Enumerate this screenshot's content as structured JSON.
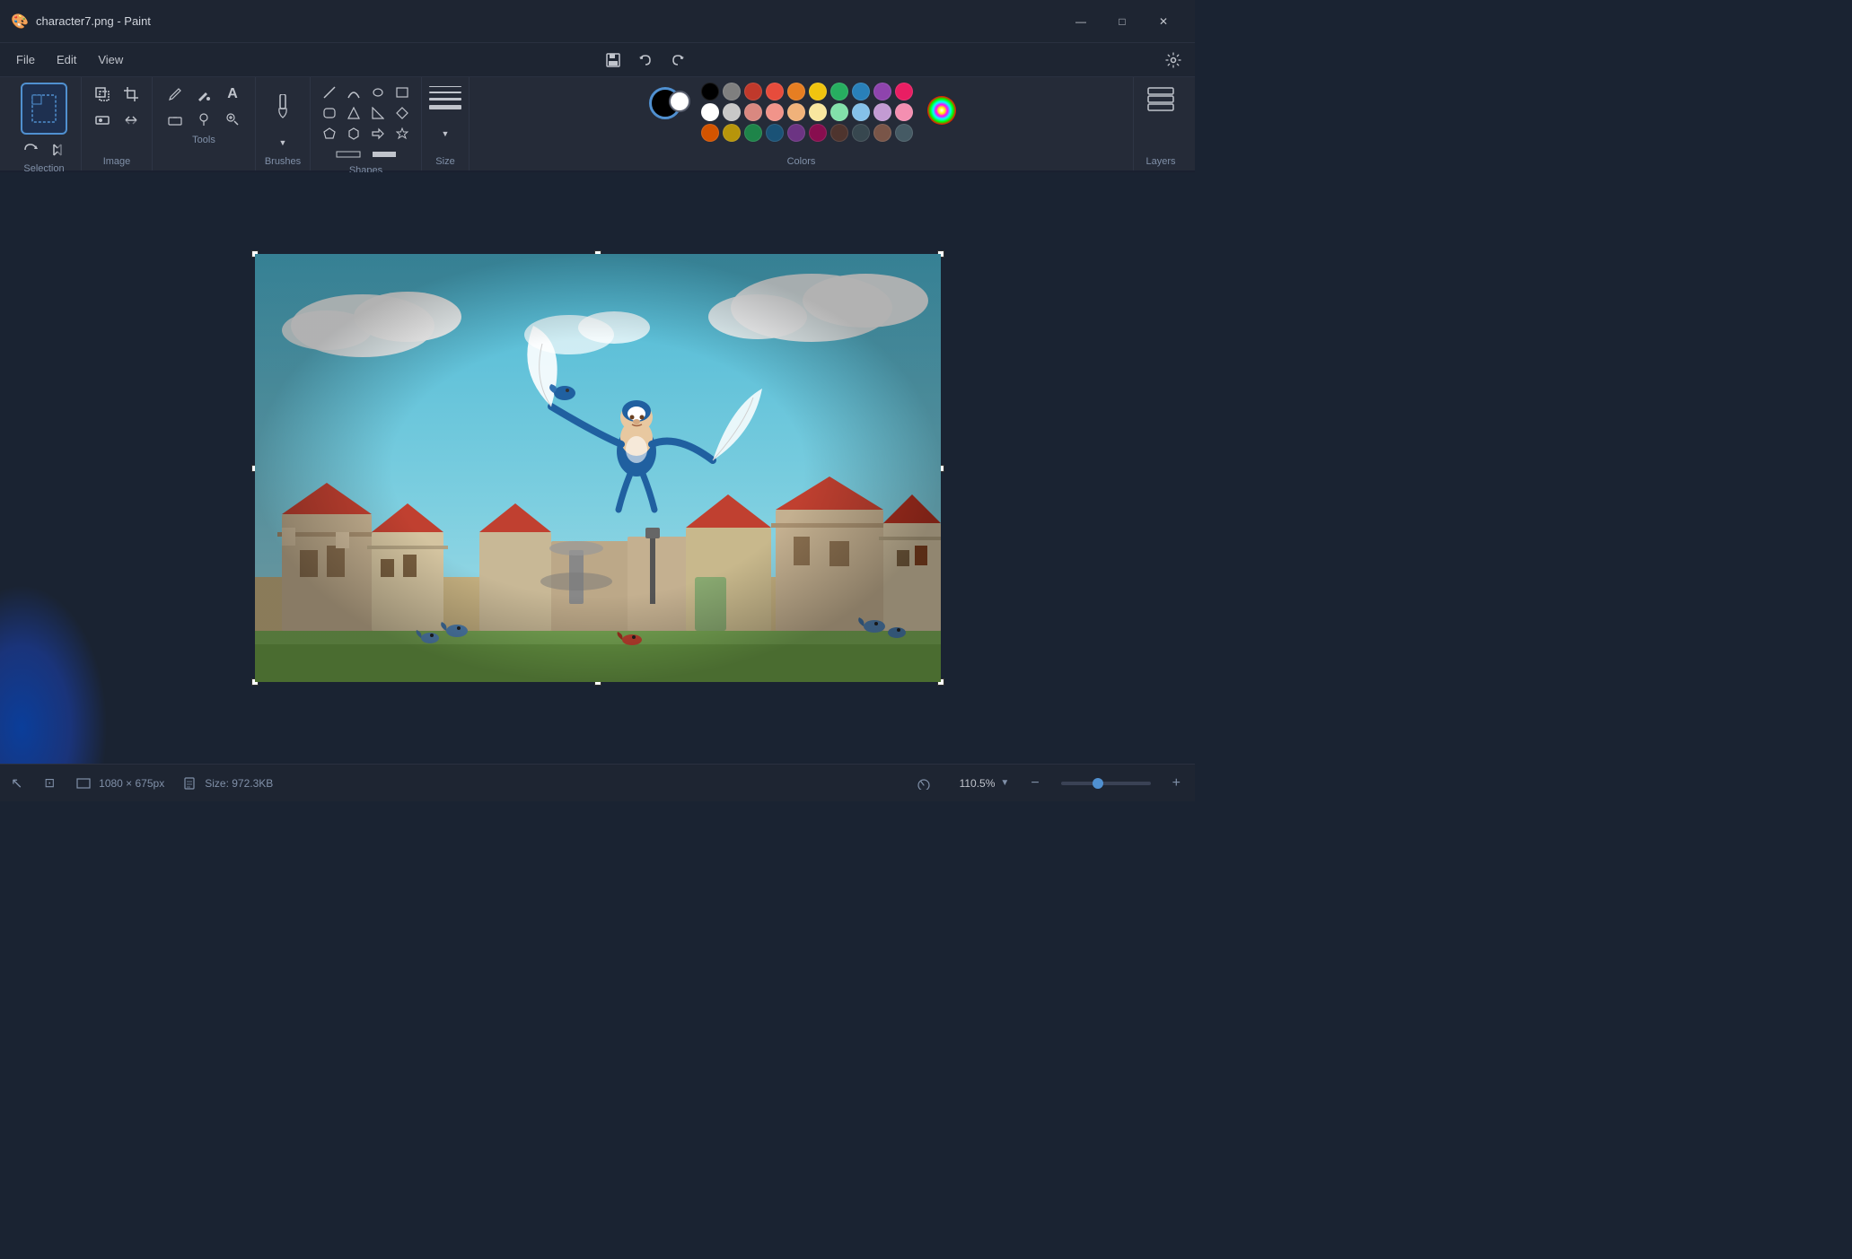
{
  "window": {
    "title": "character7.png - Paint",
    "icon": "🎨"
  },
  "titlebar": {
    "controls": {
      "minimize": "—",
      "maximize": "□",
      "close": "✕"
    }
  },
  "menubar": {
    "items": [
      "File",
      "Edit",
      "View"
    ],
    "undo_label": "↩",
    "redo_label": "↪",
    "settings_label": "⚙"
  },
  "ribbon": {
    "groups": {
      "selection": {
        "label": "Selection"
      },
      "image": {
        "label": "Image"
      },
      "tools": {
        "label": "Tools"
      },
      "brushes": {
        "label": "Brushes"
      },
      "shapes": {
        "label": "Shapes"
      },
      "size": {
        "label": "Size"
      },
      "colors": {
        "label": "Colors"
      },
      "layers": {
        "label": "Layers"
      }
    },
    "colors": {
      "active_color": "#000000",
      "secondary_color": "#ffffff",
      "palette": [
        "#000000",
        "#7f7f7f",
        "#c0392b",
        "#e74c3c",
        "#e67e22",
        "#f1c40f",
        "#27ae60",
        "#2980b9",
        "#8e44ad",
        "#e91e63",
        "#ffffff",
        "#c8c8c8",
        "#d98880",
        "#f1948a",
        "#f0b27a",
        "#f9e79f",
        "#82e0aa",
        "#85c1e9",
        "#c39bd3",
        "#f48fb1",
        "#d35400",
        "#b7950b",
        "#1e8449",
        "#1a5276",
        "#6c3483",
        "#880e4f",
        "#4e342e",
        "#37474f",
        "#795548",
        "#455a64"
      ]
    }
  },
  "statusbar": {
    "dimensions": "1080 × 675px",
    "size_label": "Size: 972.3KB",
    "zoom_level": "110.5%",
    "cursor_label": "↖"
  }
}
